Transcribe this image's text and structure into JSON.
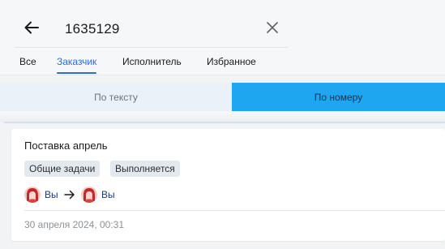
{
  "search": {
    "value": "1635129"
  },
  "tabs": [
    {
      "label": "Все",
      "active": false
    },
    {
      "label": "Заказчик",
      "active": true
    },
    {
      "label": "Исполнитель",
      "active": false
    },
    {
      "label": "Избранное",
      "active": false
    }
  ],
  "segment": {
    "options": [
      "По тексту",
      "По номеру"
    ],
    "selected": "По номеру"
  },
  "card": {
    "title": "Поставка апрель",
    "badges": [
      "Общие задачи",
      "Выполняется"
    ],
    "from_label": "Вы",
    "to_label": "Вы",
    "date": "30 апреля 2024, 00:31"
  },
  "icons": {
    "back": "arrow-left-icon",
    "clear": "close-icon",
    "arrow": "arrow-right-icon",
    "avatar": "avatar-icon"
  },
  "colors": {
    "accent": "#2f6bd8",
    "segment_active": "#1fa6f0",
    "segment_bg": "#eaf1f8",
    "badge_bg": "#e4e9ef"
  }
}
